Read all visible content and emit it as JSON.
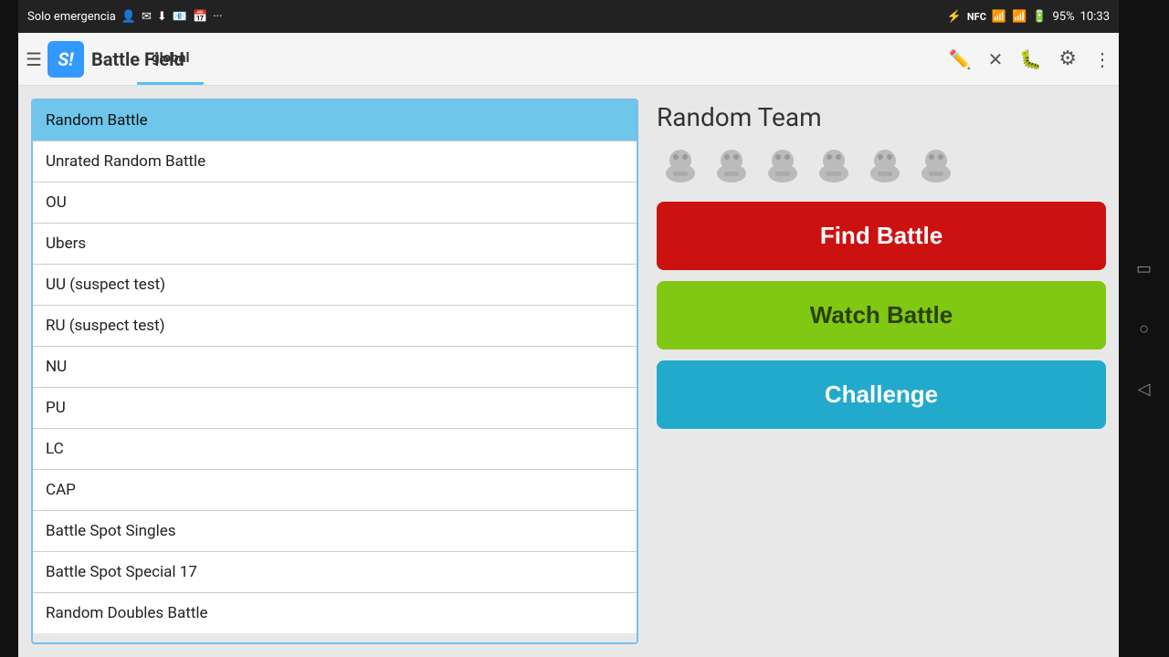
{
  "status_bar": {
    "carrier": "Solo emergencia",
    "time": "10:33",
    "battery": "95%",
    "icons": [
      "bluetooth",
      "nfc",
      "signal-off",
      "wifi",
      "battery"
    ]
  },
  "app_bar": {
    "title": "Battle Field",
    "tab": "global",
    "icons": [
      "edit",
      "close",
      "debug",
      "pokeball",
      "more"
    ]
  },
  "battle_list": {
    "items": [
      {
        "label": "Random Battle",
        "selected": true
      },
      {
        "label": "Unrated Random Battle",
        "selected": false
      },
      {
        "label": "OU",
        "selected": false
      },
      {
        "label": "Ubers",
        "selected": false
      },
      {
        "label": "UU (suspect test)",
        "selected": false
      },
      {
        "label": "RU (suspect test)",
        "selected": false
      },
      {
        "label": "NU",
        "selected": false
      },
      {
        "label": "PU",
        "selected": false
      },
      {
        "label": "LC",
        "selected": false
      },
      {
        "label": "CAP",
        "selected": false
      },
      {
        "label": "Battle Spot Singles",
        "selected": false
      },
      {
        "label": "Battle Spot Special 17",
        "selected": false
      },
      {
        "label": "Random Doubles Battle",
        "selected": false
      }
    ]
  },
  "right_panel": {
    "team_title": "Random Team",
    "pokemon_count": 6,
    "buttons": {
      "find": "Find Battle",
      "watch": "Watch Battle",
      "challenge": "Challenge"
    }
  },
  "nav_buttons": [
    "square",
    "circle",
    "triangle-left"
  ]
}
